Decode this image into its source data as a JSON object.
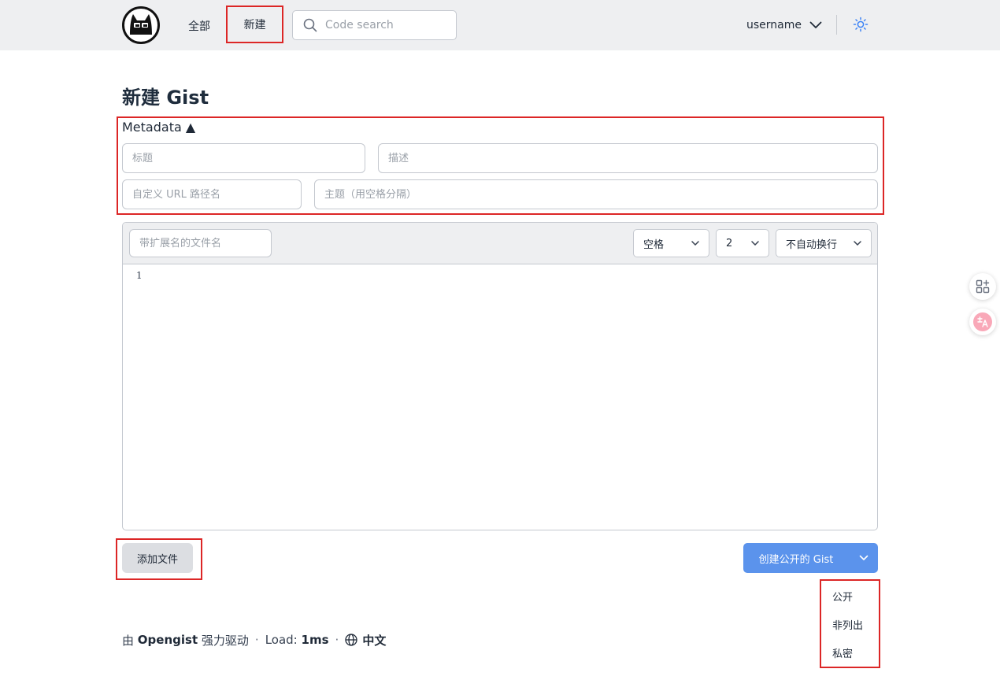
{
  "header": {
    "nav_all": "全部",
    "nav_new": "新建",
    "search_placeholder": "Code search",
    "username": "username"
  },
  "page": {
    "title": "新建 Gist"
  },
  "metadata": {
    "toggle_label": "Metadata ▲",
    "title_placeholder": "标题",
    "description_placeholder": "描述",
    "url_placeholder": "自定义 URL 路径名",
    "topics_placeholder": "主题（用空格分隔）"
  },
  "editor": {
    "filename_placeholder": "带扩展名的文件名",
    "indent_mode": "空格",
    "indent_size": "2",
    "wrap_mode": "不自动换行",
    "line_number": "1"
  },
  "actions": {
    "add_file": "添加文件",
    "create_label": "创建公开的 Gist"
  },
  "visibility_menu": {
    "items": [
      "公开",
      "非列出",
      "私密"
    ]
  },
  "footer": {
    "powered_prefix": "由",
    "brand": "Opengist",
    "powered_suffix": "强力驱动",
    "load_label": "Load:",
    "load_value": "1ms",
    "language": "中文"
  },
  "icons": {
    "logo": "opengist-logo-icon",
    "search": "search-icon",
    "user_chevron": "chevron-down-icon",
    "theme": "sun-icon",
    "select_chevron": "chevron-down-icon",
    "create_chevron": "chevron-down-icon",
    "language": "globe-icon",
    "apps_widget": "apps-widget-icon",
    "translate_widget": "translate-icon"
  },
  "colors": {
    "accent": "#5b93ec",
    "highlight_outline": "#dc2626",
    "header_bg": "#eeeff1"
  }
}
